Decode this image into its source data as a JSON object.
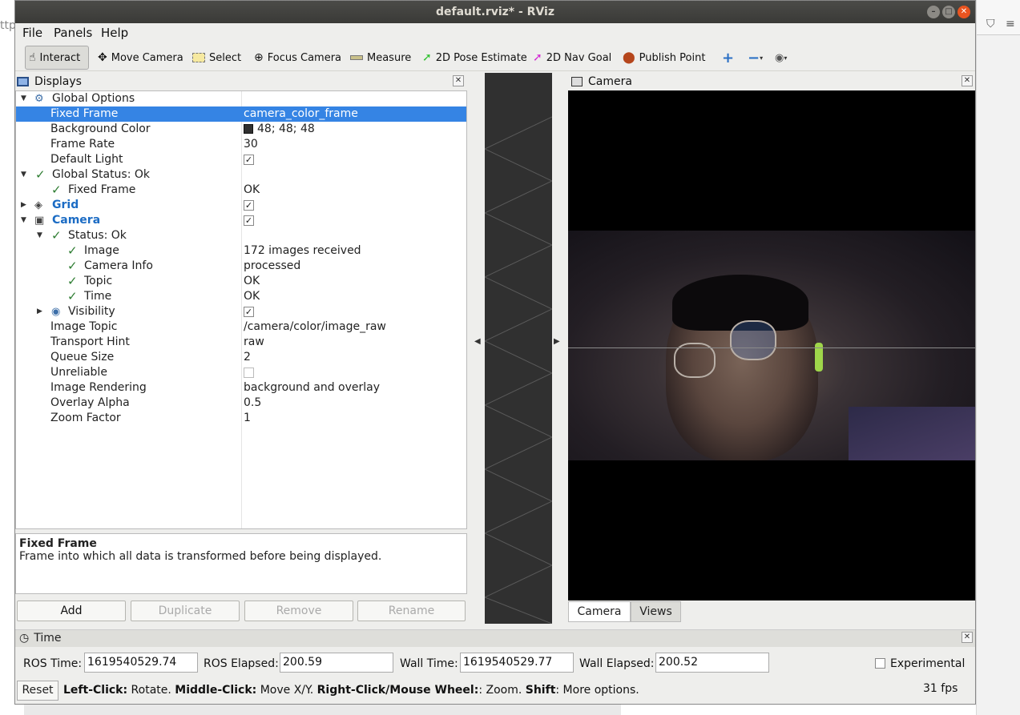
{
  "window": {
    "title": "default.rviz* - RViz"
  },
  "background": {
    "left_text": "ttp"
  },
  "menubar": {
    "file": "File",
    "panels": "Panels",
    "help": "Help"
  },
  "toolbar": {
    "interact": "Interact",
    "move_camera": "Move Camera",
    "select": "Select",
    "focus_camera": "Focus Camera",
    "measure": "Measure",
    "pose_estimate": "2D Pose Estimate",
    "nav_goal": "2D Nav Goal",
    "publish_point": "Publish Point"
  },
  "displays": {
    "title": "Displays",
    "rows": [
      {
        "label": "Global Options",
        "value": ""
      },
      {
        "label": "Fixed Frame",
        "value": "camera_color_frame"
      },
      {
        "label": "Background Color",
        "value": "48; 48; 48"
      },
      {
        "label": "Frame Rate",
        "value": "30"
      },
      {
        "label": "Default Light",
        "value": ""
      },
      {
        "label": "Global Status: Ok",
        "value": ""
      },
      {
        "label": "Fixed Frame",
        "value": "OK"
      },
      {
        "label": "Grid",
        "value": ""
      },
      {
        "label": "Camera",
        "value": ""
      },
      {
        "label": "Status: Ok",
        "value": ""
      },
      {
        "label": "Image",
        "value": "172 images received"
      },
      {
        "label": "Camera Info",
        "value": "processed"
      },
      {
        "label": "Topic",
        "value": "OK"
      },
      {
        "label": "Time",
        "value": "OK"
      },
      {
        "label": "Visibility",
        "value": ""
      },
      {
        "label": "Image Topic",
        "value": "/camera/color/image_raw"
      },
      {
        "label": "Transport Hint",
        "value": "raw"
      },
      {
        "label": "Queue Size",
        "value": "2"
      },
      {
        "label": "Unreliable",
        "value": ""
      },
      {
        "label": "Image Rendering",
        "value": "background and overlay"
      },
      {
        "label": "Overlay Alpha",
        "value": "0.5"
      },
      {
        "label": "Zoom Factor",
        "value": "1"
      }
    ],
    "description_title": "Fixed Frame",
    "description_text": "Frame into which all data is transformed before being displayed.",
    "buttons": {
      "add": "Add",
      "duplicate": "Duplicate",
      "remove": "Remove",
      "rename": "Rename"
    },
    "background_color_hex": "#303030",
    "selection_color": "#3584e4"
  },
  "camera_panel": {
    "title": "Camera",
    "tabs": [
      "Camera",
      "Views"
    ]
  },
  "time_panel": {
    "title": "Time",
    "ros_time_label": "ROS Time:",
    "ros_time": "1619540529.74",
    "ros_elapsed_label": "ROS Elapsed:",
    "ros_elapsed": "200.59",
    "wall_time_label": "Wall Time:",
    "wall_time": "1619540529.77",
    "wall_elapsed_label": "Wall Elapsed:",
    "wall_elapsed": "200.52",
    "experimental": "Experimental",
    "reset": "Reset",
    "hint_left_click_key": "Left-Click:",
    "hint_left_click": " Rotate. ",
    "hint_middle_click_key": "Middle-Click:",
    "hint_middle_click": " Move X/Y. ",
    "hint_right_click_key": "Right-Click/Mouse Wheel:",
    "hint_right_click": ": Zoom. ",
    "hint_shift_key": "Shift",
    "hint_shift": ": More options.",
    "fps": "31 fps"
  }
}
